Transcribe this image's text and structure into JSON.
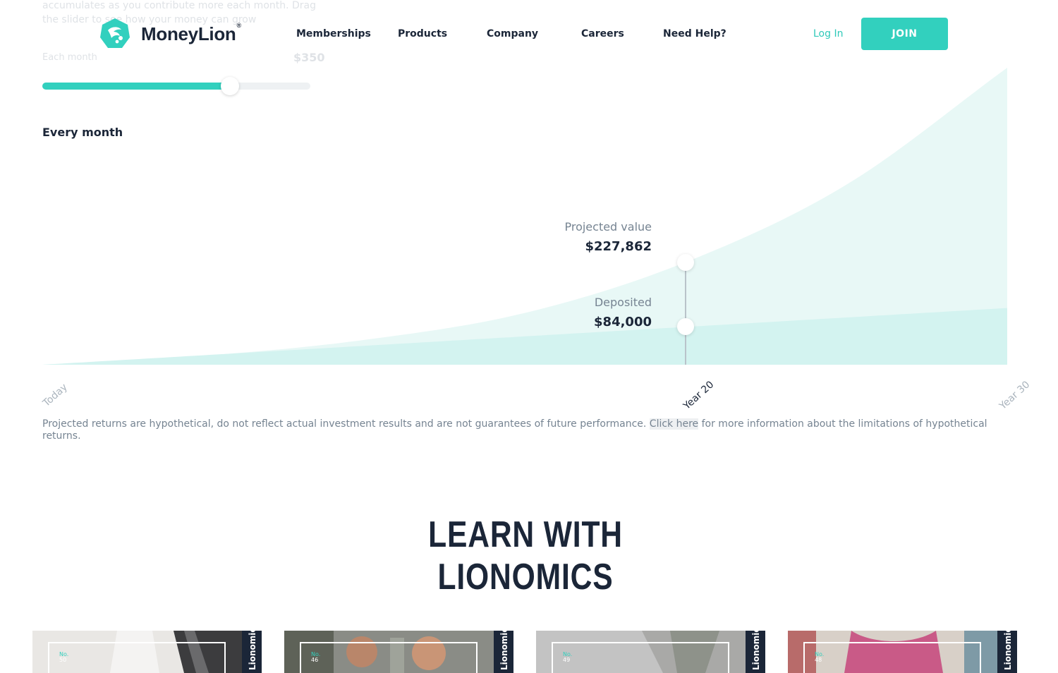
{
  "header": {
    "logo_text": "MoneyLion",
    "logo_reg": "®",
    "nav": [
      "Memberships",
      "Products",
      "Company",
      "Careers",
      "Need Help?"
    ],
    "login_label": "Log In",
    "join_label": "JOIN"
  },
  "faded_background": {
    "line1": "accumulates as you contribute more each month. Drag",
    "line2": "the slider to see how your money can grow",
    "amount_label": "Each month",
    "amount_value": "$350"
  },
  "slider": {
    "level": 0.7
  },
  "frequency_label": "Every month",
  "chart_data": {
    "type": "area",
    "x": [
      0,
      5,
      10,
      15,
      20,
      25,
      30
    ],
    "x_tick_labels": [
      "Today",
      "Year 20",
      "Year 30"
    ],
    "x_tick_positions": [
      0,
      20,
      30
    ],
    "series": [
      {
        "name": "Projected value",
        "values": [
          0,
          20000,
          55000,
          115000,
          227862,
          400000,
          660000
        ]
      },
      {
        "name": "Deposited",
        "values": [
          0,
          21000,
          42000,
          63000,
          84000,
          105000,
          126000
        ]
      }
    ],
    "ylim": [
      0,
      660000
    ],
    "selected_x": 20,
    "grid": false,
    "colors": {
      "projected": "#e8f8f6",
      "deposited": "#d3f3f0",
      "marker": "#b9c3ca"
    }
  },
  "markers": {
    "projected_label": "Projected value",
    "projected_value": "$227,862",
    "deposited_label": "Deposited",
    "deposited_value": "$84,000"
  },
  "disclaimer": {
    "text": "Projected returns are hypothetical, do not reflect actual investment results and are not guarantees of future performance. ",
    "link": "Click here",
    "text_after": " for more information about the limitations of hypothetical returns."
  },
  "learn": {
    "line1": "LEARN WITH",
    "line2": "LIONOMICS"
  },
  "cards": [
    {
      "no": "No.",
      "num": "50",
      "strip": "Lionomics"
    },
    {
      "no": "No.",
      "num": "46",
      "strip": "Lionomics"
    },
    {
      "no": "No.",
      "num": "49",
      "strip": "Lionomics"
    },
    {
      "no": "No.",
      "num": "48",
      "strip": "Lionomics"
    }
  ],
  "colors": {
    "brand_teal": "#32d0be",
    "navy": "#1b2638",
    "muted": "#768492"
  }
}
